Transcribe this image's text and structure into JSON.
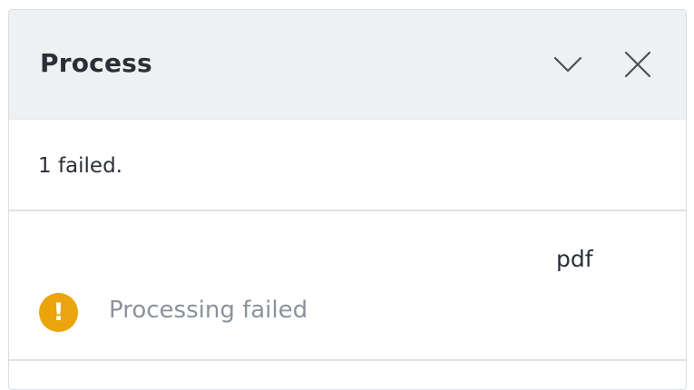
{
  "panel": {
    "title": "Process",
    "collapse_icon": "chevron-down-icon",
    "close_icon": "close-icon"
  },
  "summary": {
    "text": "1 failed."
  },
  "items": [
    {
      "file_name": "pdf",
      "status_icon": "warning-icon",
      "status_icon_glyph": "!",
      "status_text": "Processing failed",
      "status_color": "#eba40c"
    }
  ],
  "colors": {
    "header_bg": "#eef0f2",
    "text": "#2a2f36",
    "muted_text": "#8a939c",
    "warning": "#eba40c",
    "divider": "#dde2e7"
  }
}
